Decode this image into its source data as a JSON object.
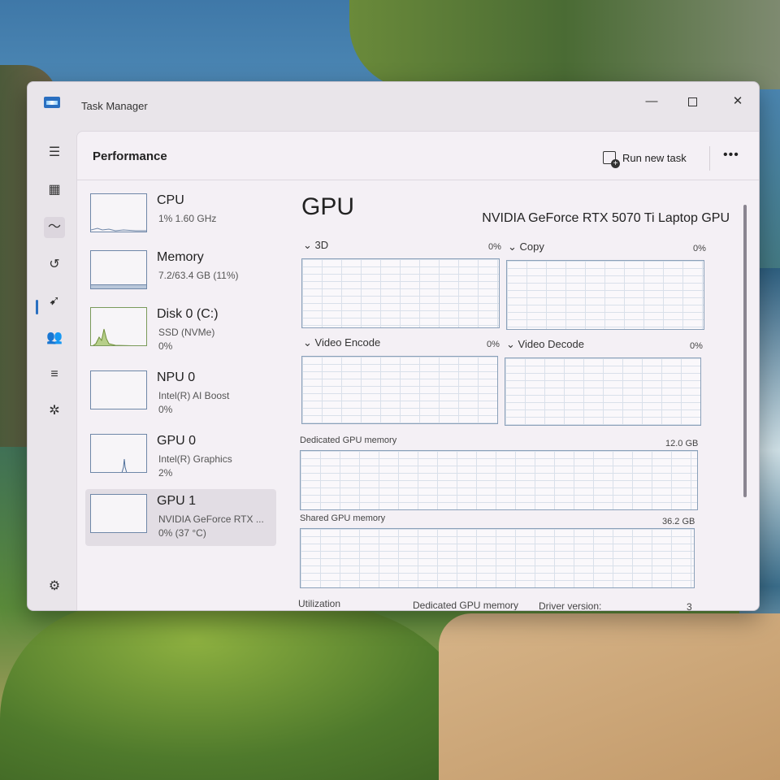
{
  "window": {
    "title": "Task Manager"
  },
  "header": {
    "section_title": "Performance",
    "run_new_task": "Run new task"
  },
  "nav": {
    "icons": [
      "menu-icon",
      "processes-icon",
      "performance-icon",
      "app-history-icon",
      "startup-apps-icon",
      "users-icon",
      "details-icon",
      "services-icon",
      "settings-icon"
    ]
  },
  "devices": [
    {
      "name": "CPU",
      "sub": "1%  1.60 GHz",
      "val": ""
    },
    {
      "name": "Memory",
      "sub": "7.2/63.4 GB (11%)",
      "val": ""
    },
    {
      "name": "Disk 0 (C:)",
      "sub": "SSD (NVMe)",
      "val": "0%"
    },
    {
      "name": "NPU 0",
      "sub": "Intel(R) AI Boost",
      "val": "0%"
    },
    {
      "name": "GPU 0",
      "sub": "Intel(R) Graphics",
      "val": "2%"
    },
    {
      "name": "GPU 1",
      "sub": "NVIDIA GeForce RTX ...",
      "val": "0% (37 °C)"
    }
  ],
  "selected_device_index": 5,
  "detail": {
    "title": "GPU",
    "model": "NVIDIA GeForce RTX 5070 Ti Laptop GPU",
    "engines": [
      {
        "label": "3D",
        "pct": "0%"
      },
      {
        "label": "Copy",
        "pct": "0%"
      },
      {
        "label": "Video Encode",
        "pct": "0%"
      },
      {
        "label": "Video Decode",
        "pct": "0%"
      }
    ],
    "dedicated_memory": {
      "label": "Dedicated GPU memory",
      "value": "12.0 GB"
    },
    "shared_memory": {
      "label": "Shared GPU memory",
      "value": "36.2 GB"
    },
    "footer": {
      "utilization": "Utilization",
      "dedicated": "Dedicated GPU memory",
      "driver": "Driver version:",
      "driver_value": "3"
    }
  }
}
